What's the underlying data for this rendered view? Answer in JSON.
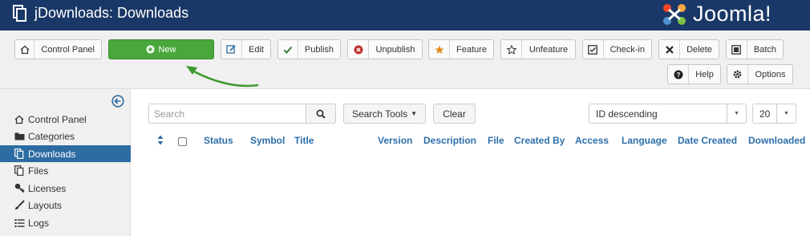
{
  "header": {
    "title": "jDownloads: Downloads",
    "brand": "Joomla!",
    "title_icon": "copy-icon",
    "brand_logo": "joomla-logo"
  },
  "toolbar": {
    "buttons": [
      {
        "label": "Control Panel",
        "icon": "home-icon"
      },
      {
        "label": "New",
        "icon": "plus-circle-icon",
        "color": "#4aa73c"
      },
      {
        "label": "Edit",
        "icon": "edit-icon"
      },
      {
        "label": "Publish",
        "icon": "checkmark-icon"
      },
      {
        "label": "Unpublish",
        "icon": "unpublish-icon"
      },
      {
        "label": "Feature",
        "icon": "star-filled-icon"
      },
      {
        "label": "Unfeature",
        "icon": "star-empty-icon"
      },
      {
        "label": "Check-in",
        "icon": "checkbox-icon"
      },
      {
        "label": "Delete",
        "icon": "x-icon"
      },
      {
        "label": "Batch",
        "icon": "batch-icon"
      },
      {
        "label": "Help",
        "icon": "question-icon"
      },
      {
        "label": "Options",
        "icon": "gear-icon"
      }
    ]
  },
  "sidebar": {
    "items": [
      {
        "label": "Control Panel",
        "icon": "home-icon",
        "active": false
      },
      {
        "label": "Categories",
        "icon": "folder-icon",
        "active": false
      },
      {
        "label": "Downloads",
        "icon": "copy-icon",
        "active": true
      },
      {
        "label": "Files",
        "icon": "files-icon",
        "active": false
      },
      {
        "label": "Licenses",
        "icon": "key-icon",
        "active": false
      },
      {
        "label": "Layouts",
        "icon": "brush-icon",
        "active": false
      },
      {
        "label": "Logs",
        "icon": "list-icon",
        "active": false
      }
    ]
  },
  "filters": {
    "search_placeholder": "Search",
    "search_tools_label": "Search Tools",
    "clear_label": "Clear",
    "ordering_value": "ID descending",
    "limit_value": "20"
  },
  "table": {
    "columns": [
      "Status",
      "Symbol",
      "Title",
      "Version",
      "Description",
      "File",
      "Created By",
      "Access",
      "Language",
      "Date Created",
      "Downloaded"
    ]
  },
  "colors": {
    "header_bg": "#1a3867",
    "active_nav": "#2d6ca2",
    "link": "#2e6fa9",
    "new_button": "#4aa73c",
    "annotation_arrow": "#3c9a2c"
  }
}
